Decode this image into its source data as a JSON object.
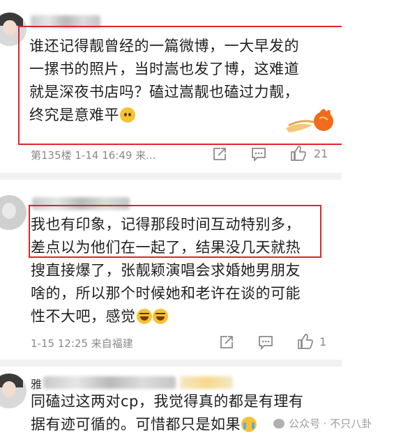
{
  "comments": [
    {
      "lines": [
        "谁还记得靓曾经的一篇微博，一大早发的",
        "一摞书的照片，当时嵩也发了博，这难道",
        "就是深夜书店吗？磕过嵩靓也磕过力靓，",
        "终究是意难平"
      ],
      "floor_time": "第135楼 1-14 16:49 来...",
      "likes": "21"
    },
    {
      "lines": [
        "我也有印象，记得那段时间互动特别多，",
        "差点以为他们在一起了，结果没几天就热",
        "搜直接爆了，张靓颖演唱会求婚她男朋友",
        "啥的，所以那个时候她和老许在谈的可能",
        "性不大吧，感觉"
      ],
      "time_location": "1-15 12:25 来自福建",
      "likes": "1"
    },
    {
      "lines": [
        "同磕过这两对cp，我觉得真的都是有理有",
        "据有迹可循的。可惜都只是如果"
      ],
      "name_prefix": "雅"
    }
  ],
  "watermark": "公众号 · 不只八卦",
  "colors": {
    "highlight": "#e0242a",
    "meta": "#8a8a8a",
    "text": "#1f1f1f"
  },
  "icons": [
    "share-icon",
    "comment-icon",
    "like-icon",
    "worried-emoji",
    "laugh-emoji",
    "cry-emoji",
    "wechat-icon"
  ]
}
